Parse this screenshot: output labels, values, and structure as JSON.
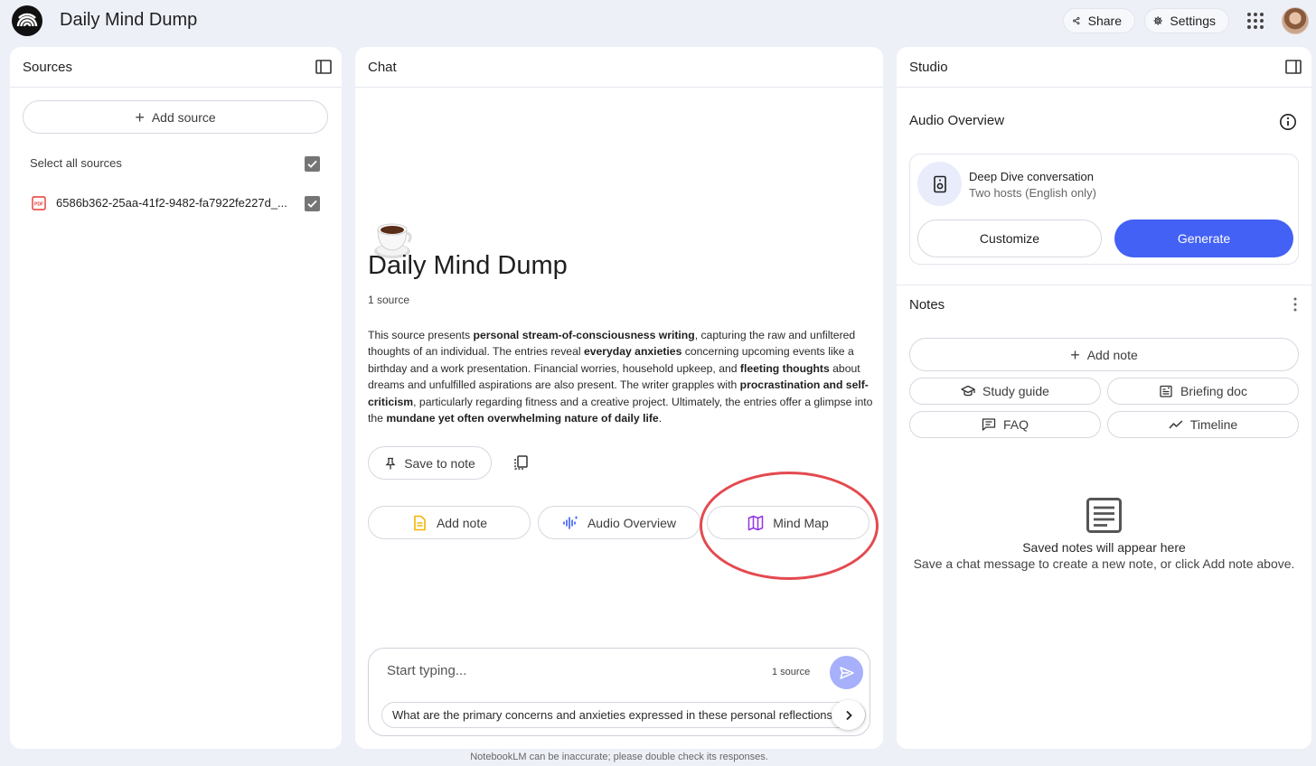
{
  "app": {
    "title": "Daily Mind Dump",
    "logo_icon": "notebooklm-logo-icon"
  },
  "header": {
    "share_label": "Share",
    "settings_label": "Settings"
  },
  "sources": {
    "title": "Sources",
    "add_source_label": "Add source",
    "select_all_label": "Select all sources",
    "items": [
      {
        "name": "6586b362-25aa-41f2-9482-fa7922fe227d_...",
        "type": "pdf",
        "checked": true
      }
    ]
  },
  "chat": {
    "title": "Chat",
    "notebook_title": "Daily Mind Dump",
    "emoji": "coffee-cup",
    "source_count": "1 source",
    "summary": [
      {
        "text": "This source presents ",
        "bold": false
      },
      {
        "text": "personal stream-of-consciousness writing",
        "bold": true
      },
      {
        "text": ", capturing the raw and unfiltered thoughts of an individual. The entries reveal ",
        "bold": false
      },
      {
        "text": "everyday anxieties",
        "bold": true
      },
      {
        "text": " concerning upcoming events like a birthday and a work presentation. Financial worries, household upkeep, and ",
        "bold": false
      },
      {
        "text": "fleeting thoughts",
        "bold": true
      },
      {
        "text": " about dreams and unfulfilled aspirations are also present. The writer grapples with ",
        "bold": false
      },
      {
        "text": "procrastination and self-criticism",
        "bold": true
      },
      {
        "text": ", particularly regarding fitness and a creative project. Ultimately, the entries offer a glimpse into the ",
        "bold": false
      },
      {
        "text": "mundane yet often overwhelming nature of daily life",
        "bold": true
      },
      {
        "text": ".",
        "bold": false
      }
    ],
    "save_to_note_label": "Save to note",
    "chips": {
      "add_note": "Add note",
      "audio_overview": "Audio Overview",
      "mind_map": "Mind Map"
    },
    "composer": {
      "placeholder": "Start typing...",
      "source_count": "1 source",
      "suggestion": "What are the primary concerns and anxieties expressed in these personal reflections?"
    },
    "disclaimer": "NotebookLM can be inaccurate; please double check its responses."
  },
  "studio": {
    "title": "Studio",
    "audio_overview": {
      "title": "Audio Overview",
      "card_title": "Deep Dive conversation",
      "card_subtitle": "Two hosts (English only)",
      "customize_label": "Customize",
      "generate_label": "Generate"
    },
    "notes": {
      "title": "Notes",
      "add_note_label": "Add note",
      "chips": {
        "study_guide": "Study guide",
        "briefing_doc": "Briefing doc",
        "faq": "FAQ",
        "timeline": "Timeline"
      },
      "empty_title": "Saved notes will appear here",
      "empty_subtitle": "Save a chat message to create a new note, or click Add note above."
    }
  },
  "colors": {
    "accent": "#4361f5",
    "highlight_ring": "#e34a50",
    "mind_map_icon": "#9334e6",
    "audio_icon": "#3b5bf6",
    "note_icon": "#f6b300",
    "pdf_icon": "#e53935"
  }
}
